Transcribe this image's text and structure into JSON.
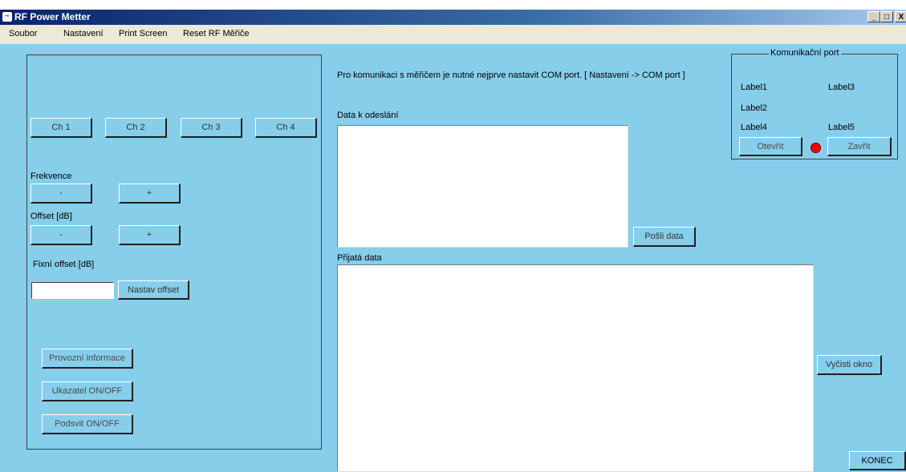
{
  "window": {
    "title": "RF Power Metter",
    "min_glyph": "_",
    "max_glyph": "□",
    "close_glyph": "X"
  },
  "menu": [
    "Soubor",
    "Nastavení",
    "Print Screen",
    "Reset RF Měřiče"
  ],
  "channels": [
    "Ch 1",
    "Ch 2",
    "Ch 3",
    "Ch 4"
  ],
  "frequency": {
    "label": "Frekvence",
    "minus": "-",
    "plus": "+"
  },
  "offset": {
    "label": "Offset [dB]",
    "minus": "-",
    "plus": "+"
  },
  "fixed_offset": {
    "label": "Fixní offset  [dB]",
    "value": "",
    "button": "Nastav offset"
  },
  "left_buttons": {
    "info": "Provozní informace",
    "indicator": "Ukazatel ON/OFF",
    "backlight": "Podsvit ON/OFF"
  },
  "hint": "Pro komunikaci s měřičem je nutné nejprve nastavit COM port. [ Nastavení -> COM port ]",
  "send": {
    "label": "Data k odeslání",
    "value": "",
    "button": "Pošli data"
  },
  "receive": {
    "label": "Přijatá data",
    "value": "",
    "clear_button": "Vyčisti okno"
  },
  "com_port": {
    "title": "Komunikační port",
    "labels": [
      "Label1",
      "Label3",
      "Label2",
      "Label4",
      "Label5"
    ],
    "open_button": "Otevřít",
    "close_button": "Zavřít",
    "status_color": "#ff0000"
  },
  "exit_button": "KONEC"
}
